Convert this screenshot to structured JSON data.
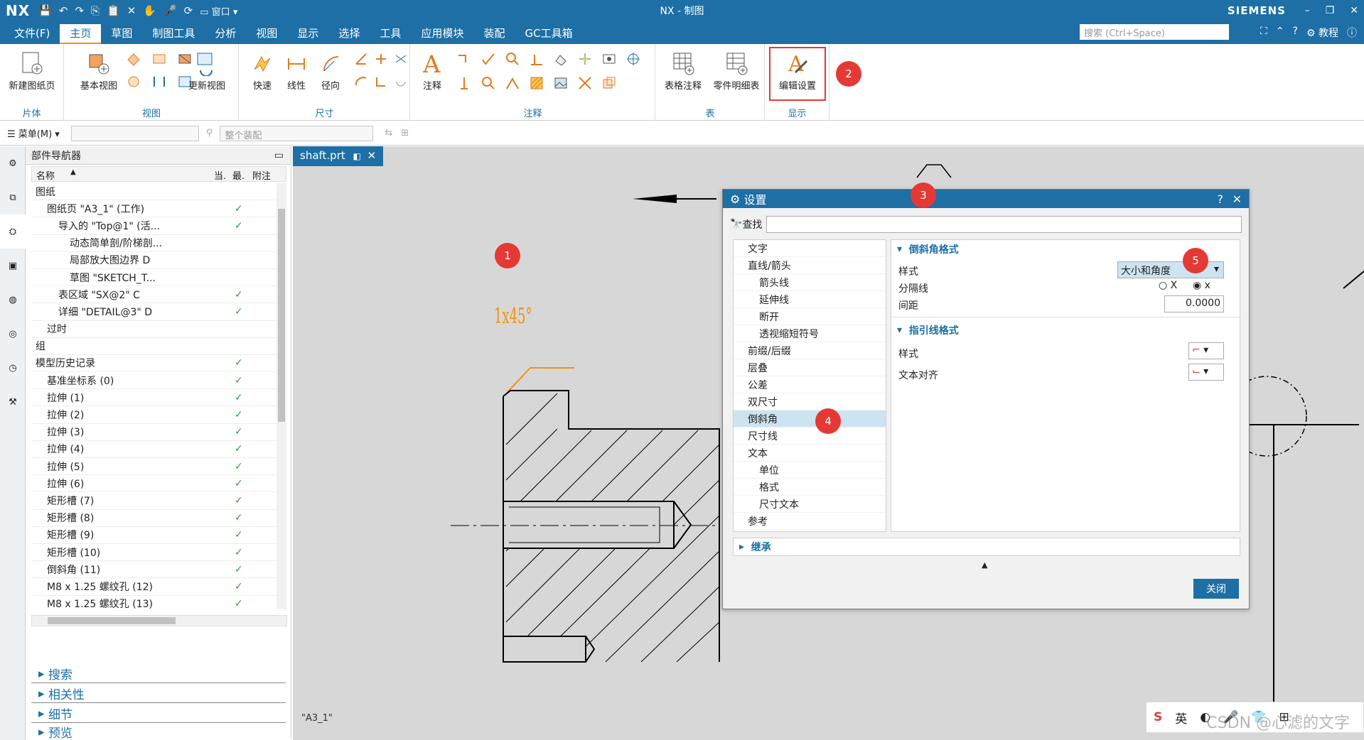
{
  "window": {
    "app_logo": "NX",
    "title": "NX - 制图",
    "brand": "SIEMENS",
    "quick_window_label": "窗口"
  },
  "menu": {
    "tabs": [
      "文件(F)",
      "主页",
      "草图",
      "制图工具",
      "分析",
      "视图",
      "显示",
      "选择",
      "工具",
      "应用模块",
      "装配",
      "GC工具箱"
    ],
    "active_tab": "主页",
    "search_placeholder": "搜索 (Ctrl+Space)",
    "tutorial_label": "教程"
  },
  "ribbon": {
    "groups": [
      {
        "label": "片体",
        "buttons": [
          "新建图纸页"
        ]
      },
      {
        "label": "视图",
        "buttons": [
          "基本视图",
          "更新视图"
        ]
      },
      {
        "label": "尺寸",
        "buttons": [
          "快速",
          "线性",
          "径向"
        ]
      },
      {
        "label": "注释",
        "buttons": [
          "注释"
        ]
      },
      {
        "label": "表",
        "buttons": [
          "表格注释",
          "零件明细表"
        ]
      },
      {
        "label": "显示",
        "buttons": [
          "编辑设置"
        ]
      }
    ]
  },
  "toolbar2": {
    "menu_label": "菜单(M)",
    "assembly_placeholder": "整个装配"
  },
  "navigator": {
    "title": "部件导航器",
    "columns": [
      "名称",
      "当.",
      "最.",
      "附注"
    ],
    "rows": [
      {
        "label": "图纸",
        "indent": 0,
        "checked": false
      },
      {
        "label": "图纸页 \"A3_1\" (工作)",
        "indent": 1,
        "checked": true
      },
      {
        "label": "导入的 \"Top@1\" (活...",
        "indent": 2,
        "checked": true
      },
      {
        "label": "动态简单剖/阶梯剖...",
        "indent": 3,
        "checked": false
      },
      {
        "label": "局部放大图边界 D",
        "indent": 3,
        "checked": false
      },
      {
        "label": "草图 \"SKETCH_T...",
        "indent": 3,
        "checked": false
      },
      {
        "label": "表区域 \"SX@2\" C",
        "indent": 2,
        "checked": true
      },
      {
        "label": "详细 \"DETAIL@3\" D",
        "indent": 2,
        "checked": true
      },
      {
        "label": "过时",
        "indent": 1,
        "checked": false
      },
      {
        "label": "组",
        "indent": 0,
        "checked": false
      },
      {
        "label": "模型历史记录",
        "indent": 0,
        "checked": true
      },
      {
        "label": "基准坐标系 (0)",
        "indent": 1,
        "checked": true
      },
      {
        "label": "拉伸 (1)",
        "indent": 1,
        "checked": true
      },
      {
        "label": "拉伸 (2)",
        "indent": 1,
        "checked": true
      },
      {
        "label": "拉伸 (3)",
        "indent": 1,
        "checked": true
      },
      {
        "label": "拉伸 (4)",
        "indent": 1,
        "checked": true
      },
      {
        "label": "拉伸 (5)",
        "indent": 1,
        "checked": true
      },
      {
        "label": "拉伸 (6)",
        "indent": 1,
        "checked": true
      },
      {
        "label": "矩形槽 (7)",
        "indent": 1,
        "checked": true
      },
      {
        "label": "矩形槽 (8)",
        "indent": 1,
        "checked": true
      },
      {
        "label": "矩形槽 (9)",
        "indent": 1,
        "checked": true
      },
      {
        "label": "矩形槽 (10)",
        "indent": 1,
        "checked": true
      },
      {
        "label": "倒斜角 (11)",
        "indent": 1,
        "checked": true
      },
      {
        "label": "M8 x 1.25 螺纹孔 (12)",
        "indent": 1,
        "checked": true
      },
      {
        "label": "M8 x 1.25 螺纹孔 (13)",
        "indent": 1,
        "checked": true
      }
    ],
    "accordions": [
      "搜索",
      "相关性",
      "细节",
      "预览"
    ]
  },
  "document": {
    "tab_label": "shaft.prt",
    "sheet_label": "\"A3_1\"",
    "chamfer_text": "1x45°"
  },
  "dialog": {
    "title": "设置",
    "search_label": "查找",
    "tree": [
      {
        "label": "文字",
        "level": 0
      },
      {
        "label": "直线/箭头",
        "level": 0
      },
      {
        "label": "箭头线",
        "level": 1
      },
      {
        "label": "延伸线",
        "level": 1
      },
      {
        "label": "断开",
        "level": 1
      },
      {
        "label": "透视缩短符号",
        "level": 1
      },
      {
        "label": "前缀/后缀",
        "level": 0
      },
      {
        "label": "层叠",
        "level": 0
      },
      {
        "label": "公差",
        "level": 0
      },
      {
        "label": "双尺寸",
        "level": 0
      },
      {
        "label": "倒斜角",
        "level": 0
      },
      {
        "label": "尺寸线",
        "level": 0
      },
      {
        "label": "文本",
        "level": 0
      },
      {
        "label": "单位",
        "level": 1
      },
      {
        "label": "格式",
        "level": 1
      },
      {
        "label": "尺寸文本",
        "level": 1
      },
      {
        "label": "参考",
        "level": 0
      }
    ],
    "selected": "倒斜角",
    "chamfer_section": {
      "title": "倒斜角格式",
      "style_label": "样式",
      "style_value": "大小和角度",
      "separator_label": "分隔线",
      "sep_option_upper": "X",
      "sep_option_lower": "x",
      "spacing_label": "间距",
      "spacing_value": "0.0000"
    },
    "leader_section": {
      "title": "指引线格式",
      "style_label": "样式",
      "align_label": "文本对齐"
    },
    "inherit_label": "继承",
    "close_label": "关闭"
  },
  "annotations": {
    "badges": [
      "1",
      "2",
      "3",
      "4",
      "5"
    ],
    "color": "#e53935"
  },
  "ime": {
    "lang_label": "英",
    "watermark": "CSDN @心滤的文字"
  },
  "colors": {
    "brand_blue": "#1d6fa5",
    "accent_orange": "#f29111",
    "check_green": "#2ea043"
  }
}
